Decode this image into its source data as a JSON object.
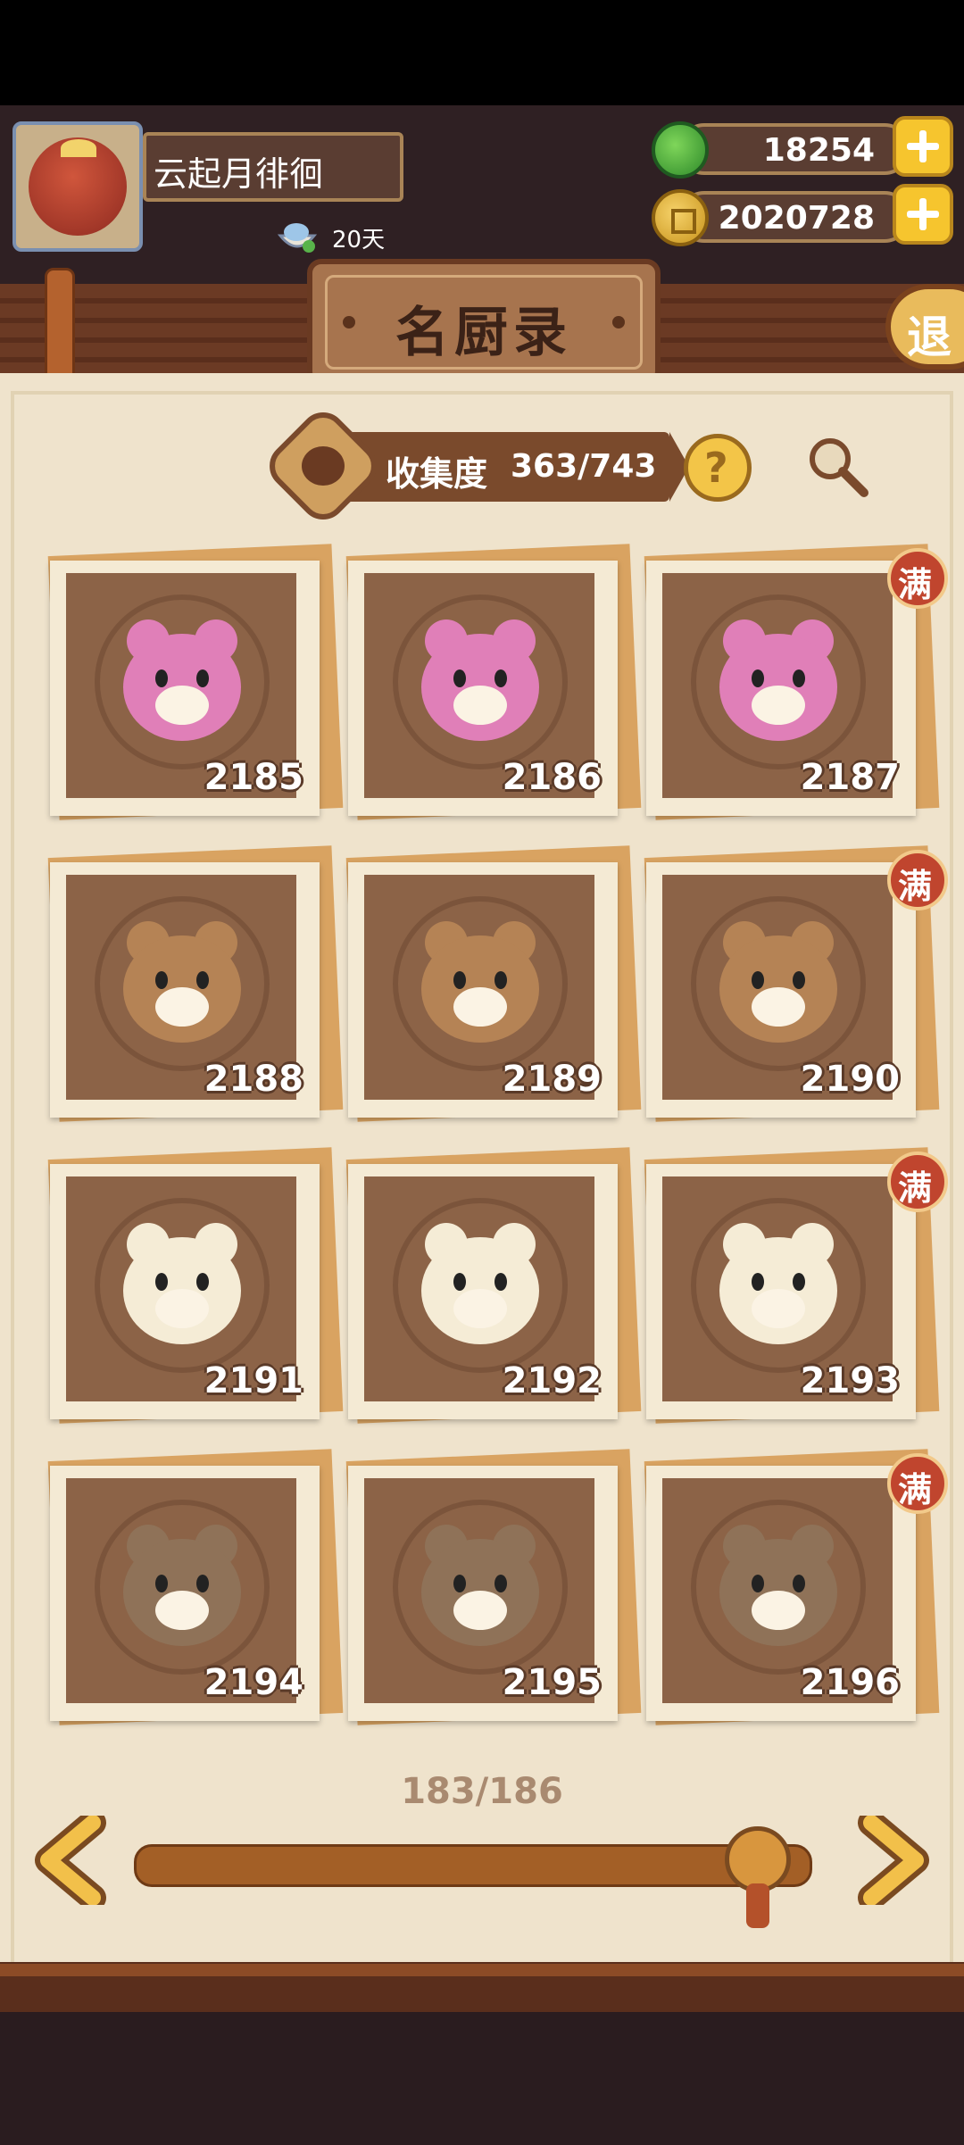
{
  "player": {
    "name": "云起月徘徊",
    "days": "20天"
  },
  "currency": {
    "jade": "18254",
    "coins": "2020728"
  },
  "page_title": "名厨录",
  "exit_label": "退",
  "collection": {
    "label": "收集度",
    "value": "363/743"
  },
  "help_symbol": "?",
  "full_badge": "满",
  "cards": [
    {
      "id": "2185",
      "full": false,
      "color": "#e07fb8"
    },
    {
      "id": "2186",
      "full": false,
      "color": "#e07fb8"
    },
    {
      "id": "2187",
      "full": true,
      "color": "#e07fb8"
    },
    {
      "id": "2188",
      "full": false,
      "color": "#b58355"
    },
    {
      "id": "2189",
      "full": false,
      "color": "#b58355"
    },
    {
      "id": "2190",
      "full": true,
      "color": "#b58355"
    },
    {
      "id": "2191",
      "full": false,
      "color": "#f5ecd6"
    },
    {
      "id": "2192",
      "full": false,
      "color": "#f5ecd6"
    },
    {
      "id": "2193",
      "full": true,
      "color": "#f5ecd6"
    },
    {
      "id": "2194",
      "full": false,
      "color": "#8f7258"
    },
    {
      "id": "2195",
      "full": false,
      "color": "#8f7258"
    },
    {
      "id": "2196",
      "full": true,
      "color": "#8f7258"
    }
  ],
  "pagination": {
    "current": "183/186",
    "progress_fraction": 0.98
  }
}
